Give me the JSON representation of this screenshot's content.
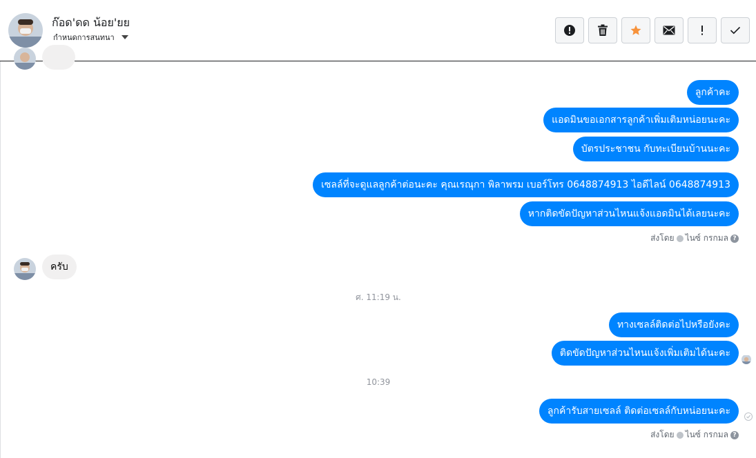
{
  "header": {
    "contact_name": "ก๊อด'ดด น้อย'ยย",
    "assign_label": "กำหนดการสนทนา",
    "toolbar": [
      {
        "icon": "alert-circle-icon"
      },
      {
        "icon": "trash-icon"
      },
      {
        "icon": "star-icon",
        "color": "#f7923b"
      },
      {
        "icon": "envelope-icon"
      },
      {
        "icon": "exclamation-icon"
      },
      {
        "icon": "checkmark-icon"
      }
    ]
  },
  "messages": {
    "out_group_1": [
      "ลูกค้าคะ",
      "แอดมินขอเอกสารลูกค้าเพิ่มเติมหน่อยนะคะ",
      "บัตรประชาชน กับทะเบียนบ้านนะคะ"
    ],
    "out_group_2": [
      "เซลล์ที่จะดูแลลูกค้าต่อนะคะ คุณเรณุกา พิลาพรม เบอร์โทร 0648874913  ไอดีไลน์ 0648874913",
      "หากติดขัดปัญหาส่วนไหนแจ้งแอดมินได้เลยนะคะ"
    ],
    "sent_by_1": {
      "prefix": "ส่งโดย",
      "name": "ไนซ์ กรกมล"
    },
    "in_reply": "ครับ",
    "time_1": "ศ. 11:19 น.",
    "out_group_3": [
      "ทางเซลล์ติดต่อไปหรือยังคะ",
      "ติดขัดปัญหาส่วนไหนแจ้งเพิ่มเติมได้นะคะ"
    ],
    "time_2": "10:39",
    "out_group_4": [
      "ลูกค้ารับสายเซลล์ ติดต่อเซลล์กับหน่อยนะคะ"
    ],
    "sent_by_2": {
      "prefix": "ส่งโดย",
      "name": "ไนซ์ กรกมล"
    }
  },
  "colors": {
    "bubble_out": "#0084ff",
    "bubble_in": "#f1f0f0",
    "star": "#f7923b"
  }
}
